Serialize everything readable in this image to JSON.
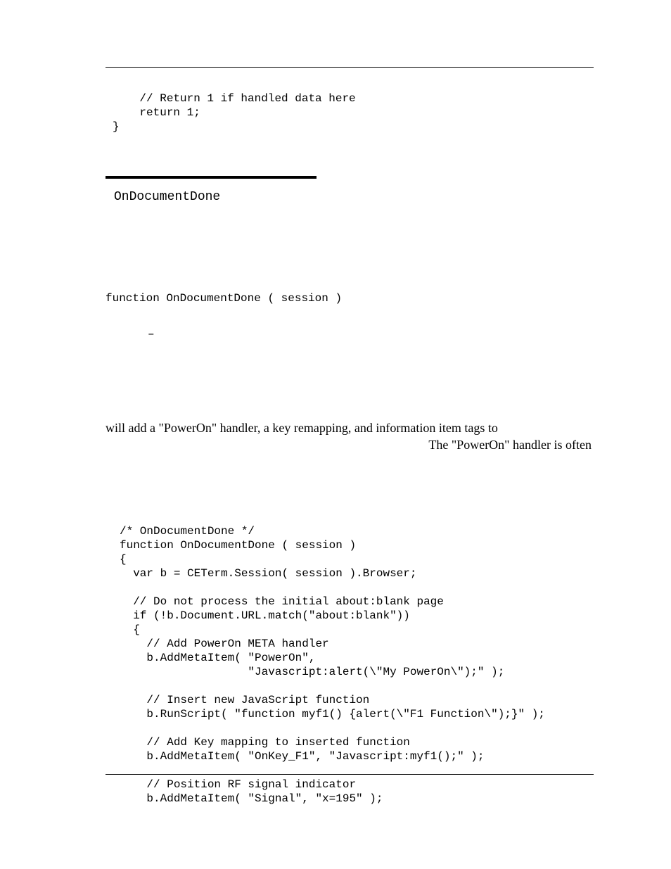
{
  "code_top": "    // Return 1 if handled data here\n    return 1;\n}",
  "section_title": "OnDocumentDone",
  "signature": "function OnDocumentDone ( session )",
  "dash_glyph": "–",
  "para_line1": "will add a \"PowerOn\" handler, a key remapping, and information item tags to",
  "para_line2": "The \"PowerOn\" handler is often",
  "code_main": "/* OnDocumentDone */\nfunction OnDocumentDone ( session )\n{\n  var b = CETerm.Session( session ).Browser;\n\n  // Do not process the initial about:blank page\n  if (!b.Document.URL.match(\"about:blank\"))\n  {\n    // Add PowerOn META handler\n    b.AddMetaItem( \"PowerOn\",\n                   \"Javascript:alert(\\\"My PowerOn\\\");\" );\n\n    // Insert new JavaScript function\n    b.RunScript( \"function myf1() {alert(\\\"F1 Function\\\");}\" );\n\n    // Add Key mapping to inserted function\n    b.AddMetaItem( \"OnKey_F1\", \"Javascript:myf1();\" );\n\n    // Position RF signal indicator\n    b.AddMetaItem( \"Signal\", \"x=195\" );"
}
